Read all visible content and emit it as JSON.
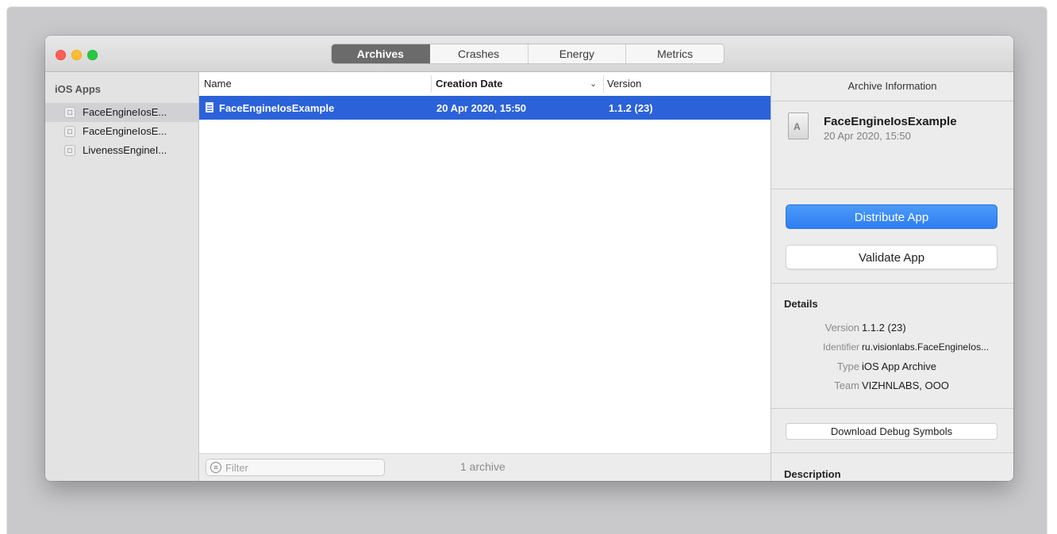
{
  "tabs": [
    {
      "label": "Archives",
      "active": true
    },
    {
      "label": "Crashes",
      "active": false
    },
    {
      "label": "Energy",
      "active": false
    },
    {
      "label": "Metrics",
      "active": false
    }
  ],
  "sidebar": {
    "header": "iOS Apps",
    "items": [
      {
        "label": "FaceEngineIosE...",
        "icon": "app-placeholder-icon",
        "selected": true
      },
      {
        "label": "FaceEngineIosE...",
        "icon": "app-placeholder-icon",
        "selected": false
      },
      {
        "label": "LivenessEngineI...",
        "icon": "app-placeholder-icon",
        "selected": false
      }
    ]
  },
  "list": {
    "columns": {
      "name": "Name",
      "creation_date": "Creation Date",
      "version": "Version",
      "sort_indicator": "⌄"
    },
    "rows": [
      {
        "name": "FaceEngineIosExample",
        "creation_date": "20 Apr 2020, 15:50",
        "version": "1.1.2 (23)",
        "icon": "document-icon",
        "selected": true
      }
    ],
    "filter_placeholder": "Filter",
    "count_text": "1 archive"
  },
  "inspector": {
    "header": "Archive Information",
    "archive_name": "FaceEngineIosExample",
    "archive_date": "20 Apr 2020, 15:50",
    "distribute_label": "Distribute App",
    "validate_label": "Validate App",
    "details_title": "Details",
    "details": {
      "version_key": "Version",
      "version_val": "1.1.2 (23)",
      "identifier_key": "Identifier",
      "identifier_val": "ru.visionlabs.FaceEngineIos...",
      "type_key": "Type",
      "type_val": "iOS App Archive",
      "team_key": "Team",
      "team_val": "VIZHNLABS, OOO"
    },
    "download_symbols_label": "Download Debug Symbols",
    "description_title": "Description"
  },
  "colors": {
    "selection": "#2b62d9",
    "primary_button": "#2f7ef3",
    "close": "#fe5f57",
    "minimize": "#febc2e",
    "zoom": "#28c840"
  }
}
